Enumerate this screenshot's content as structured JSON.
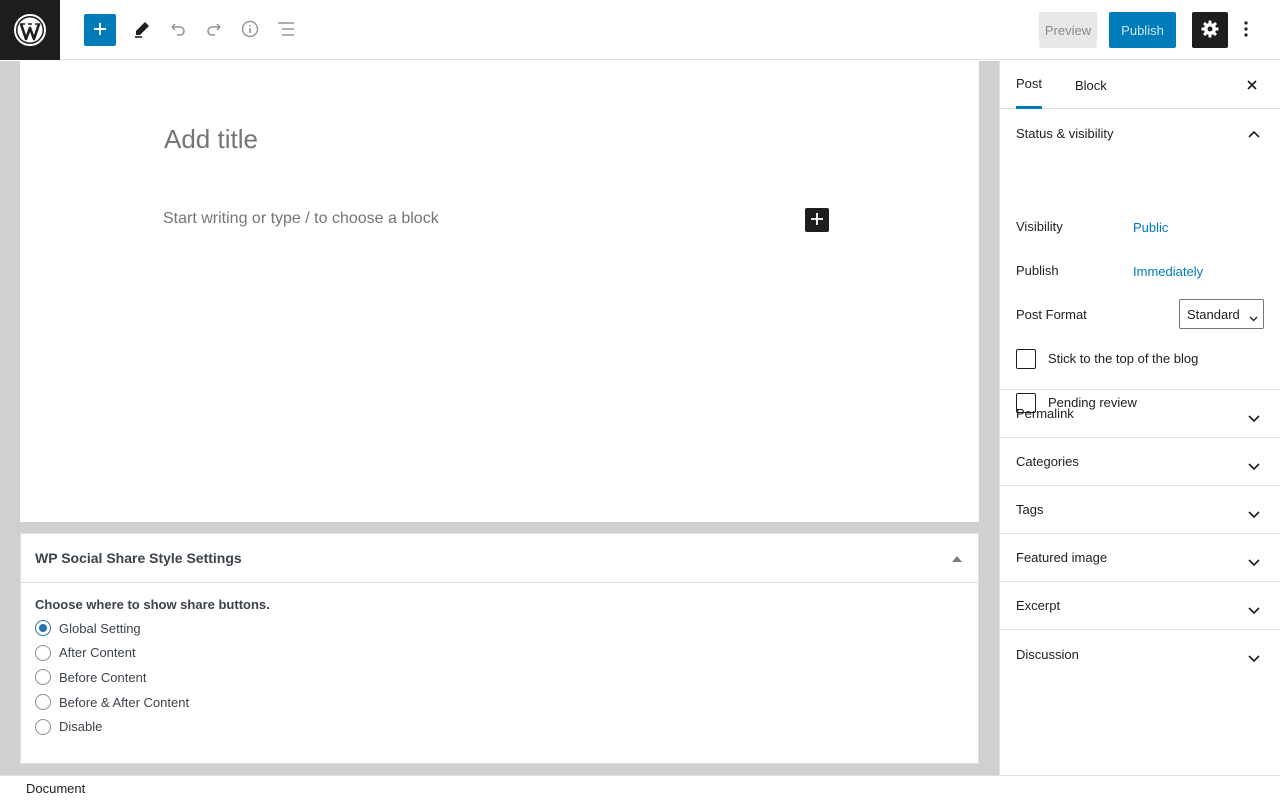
{
  "toolbar": {
    "logo_icon": "wordpress-logo-icon",
    "inserter_icon": "plus-icon",
    "tools_icon": "pencil-icon",
    "undo_icon": "undo-icon",
    "redo_icon": "redo-icon",
    "details_icon": "info-icon",
    "list_view_icon": "list-view-icon",
    "preview_label": "Preview",
    "publish_label": "Publish",
    "settings_icon": "gear-icon",
    "more_icon": "more-vertical-icon"
  },
  "editor": {
    "title_placeholder": "Add title",
    "paragraph_placeholder": "Start writing or type / to choose a block"
  },
  "metabox": {
    "title": "WP Social Share Style Settings",
    "label": "Choose where to show share buttons.",
    "options": [
      "Global Setting",
      "After Content",
      "Before Content",
      "Before & After Content",
      "Disable"
    ],
    "selected": "Global Setting"
  },
  "sidebar": {
    "tabs": [
      {
        "label": "Post",
        "active": true
      },
      {
        "label": "Block",
        "active": false
      }
    ],
    "status": {
      "title": "Status & visibility",
      "visibility_label": "Visibility",
      "visibility_value": "Public",
      "publish_label": "Publish",
      "publish_value": "Immediately",
      "post_format_label": "Post Format",
      "post_format_value": "Standard",
      "sticky_label": "Stick to the top of the blog",
      "pending_label": "Pending review"
    },
    "panels": [
      "Permalink",
      "Categories",
      "Tags",
      "Featured image",
      "Excerpt",
      "Discussion"
    ]
  },
  "footer": {
    "breadcrumb": "Document"
  },
  "colors": {
    "accent": "#007cba",
    "dark": "#1e1e1e"
  }
}
